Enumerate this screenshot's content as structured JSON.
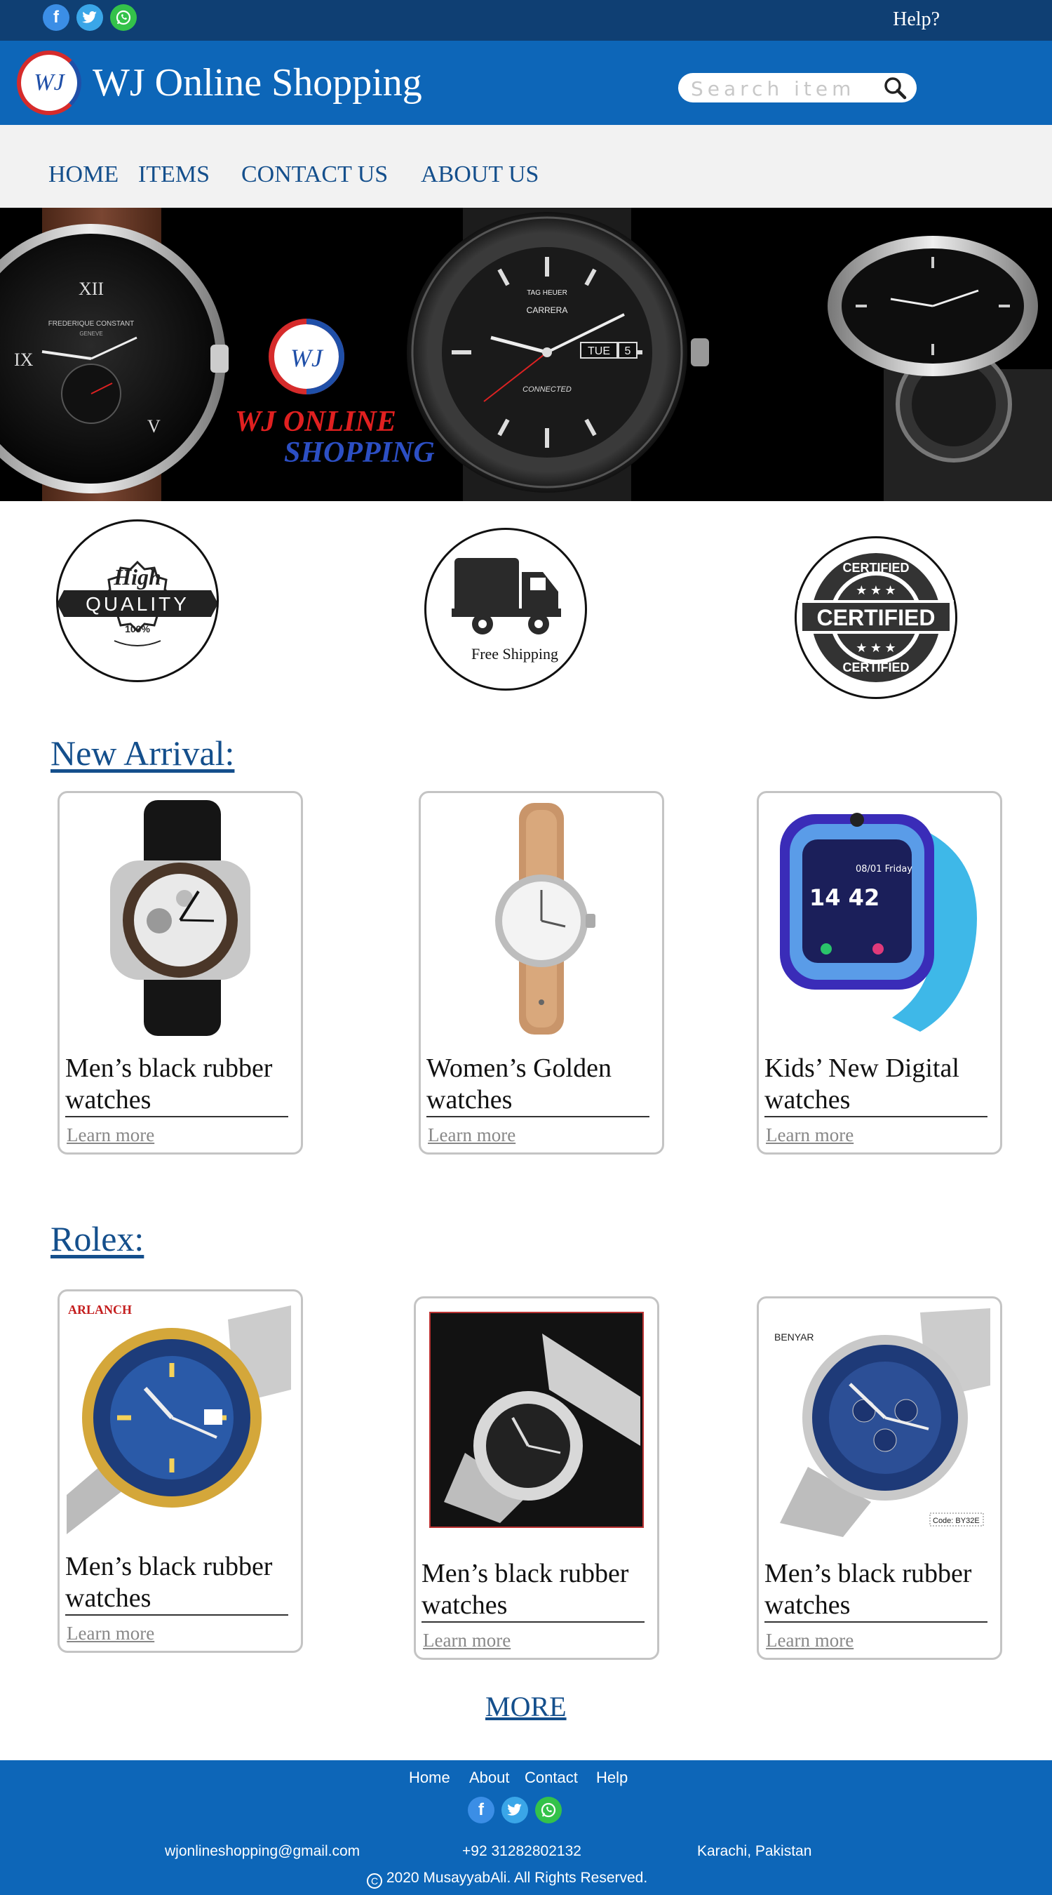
{
  "topbar": {
    "social_icons": [
      "facebook-icon",
      "twitter-icon",
      "whatsapp-icon"
    ],
    "help_label": "Help?"
  },
  "header": {
    "logo_text": "WJ",
    "title": "WJ Online Shopping",
    "search_placeholder": "Search item"
  },
  "nav": {
    "items": [
      {
        "label": "HOME"
      },
      {
        "label": "ITEMS"
      },
      {
        "label": "CONTACT US"
      },
      {
        "label": "ABOUT US"
      }
    ]
  },
  "banner": {
    "logo_text": "WJ",
    "brand_line1": "WJ ONLINE",
    "brand_line2": "SHOPPING",
    "watch1": {
      "brand": "FREDERIQUE CONSTANT",
      "city": "GENEVE",
      "numeral_top": "XII",
      "numeral_left": "IX",
      "numeral_bottom": "V"
    },
    "watch2": {
      "brand": "TAG HEUER",
      "model": "CARRERA",
      "date_day": "TUE",
      "date_num": "5",
      "connected": "CONNECTED"
    }
  },
  "badges": {
    "quality": {
      "top": "High",
      "middle": "QUALITY",
      "bottom": "100%"
    },
    "shipping": {
      "label": "Free Shipping"
    },
    "certified": {
      "top": "CERTIFIED",
      "middle": "CERTIFIED",
      "bottom": "CERTIFIED"
    }
  },
  "new_arrival": {
    "title": "New Arrival:",
    "products": [
      {
        "title": "Men’s black rubber watches",
        "link": "Learn more"
      },
      {
        "title": "Women’s Golden watches",
        "link": "Learn more"
      },
      {
        "title": "Kids’ New Digital watches",
        "link": "Learn more",
        "screen_time": "14 42",
        "screen_date": "08/01 Friday"
      }
    ]
  },
  "rolex": {
    "title": "Rolex:",
    "products": [
      {
        "title": "Men’s black rubber watches",
        "link": "Learn more",
        "brand_tag": "ARLANCH"
      },
      {
        "title": "Men’s black rubber watches",
        "link": "Learn more"
      },
      {
        "title": "Men’s black rubber watches",
        "link": "Learn more",
        "brand_tag": "BENYAR",
        "code_tag": "Code: BY32E"
      }
    ]
  },
  "more_label": "MORE",
  "footer": {
    "links": [
      "Home",
      "About",
      "Contact",
      "Help"
    ],
    "email": "wjonlineshopping@gmail.com",
    "phone": "+92 31282802132",
    "location": "Karachi, Pakistan",
    "copyright": "2020 MusayyabAli. All Rights Reserved."
  },
  "colors": {
    "topbar": "#0f3f73",
    "header": "#0d66b8",
    "nav_bg": "#f2f2f2",
    "nav_text": "#144f8c",
    "footer": "#0d66b8",
    "brand_red": "#d62b2b",
    "brand_blue": "#1f4fa8"
  }
}
